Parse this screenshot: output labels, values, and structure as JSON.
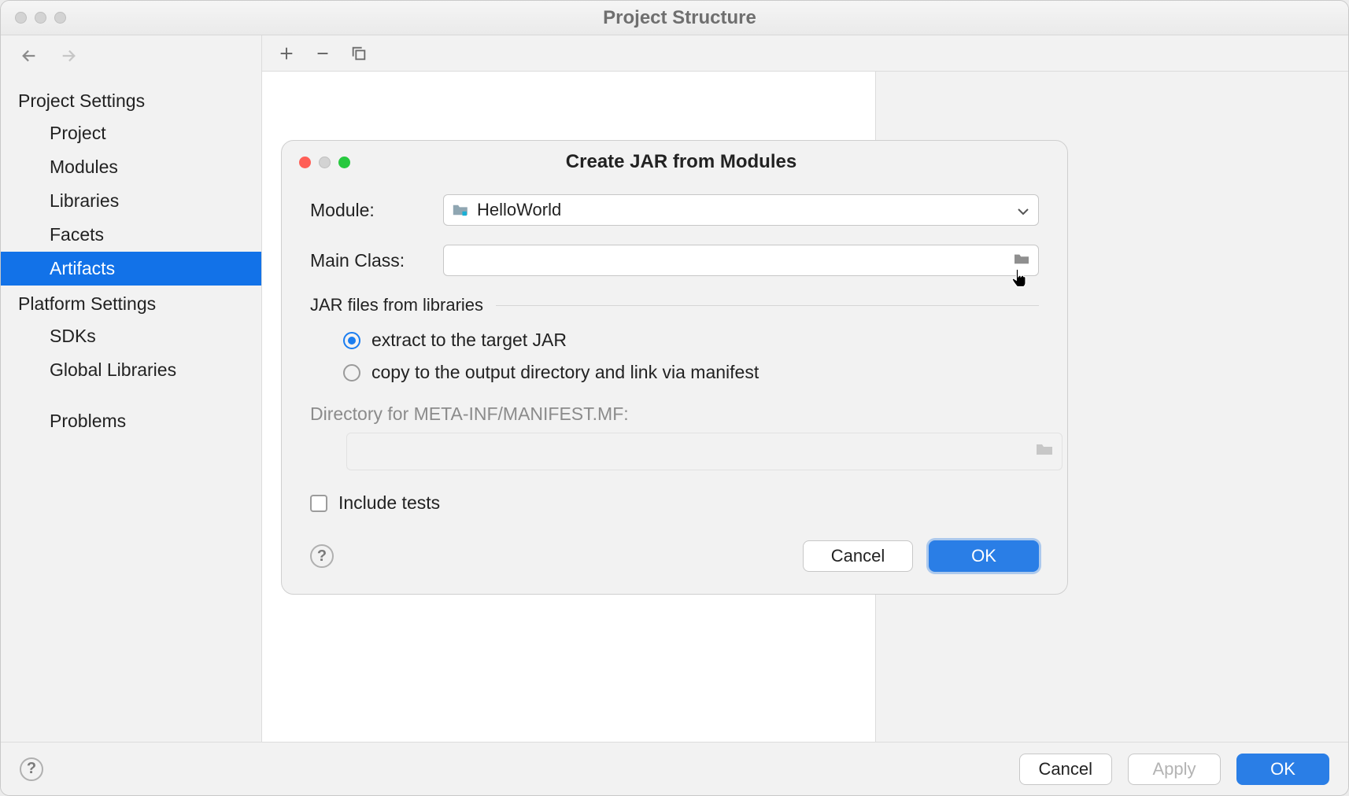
{
  "window": {
    "title": "Project Structure"
  },
  "sidebar": {
    "section1": "Project Settings",
    "items1": [
      "Project",
      "Modules",
      "Libraries",
      "Facets",
      "Artifacts"
    ],
    "section2": "Platform Settings",
    "items2": [
      "SDKs",
      "Global Libraries"
    ],
    "section3": "",
    "items3": [
      "Problems"
    ]
  },
  "footer": {
    "cancel": "Cancel",
    "apply": "Apply",
    "ok": "OK"
  },
  "dialog": {
    "title": "Create JAR from Modules",
    "module_label": "Module:",
    "module_value": "HelloWorld",
    "mainclass_label": "Main Class:",
    "mainclass_value": "",
    "jar_section": "JAR files from libraries",
    "radio_extract": "extract to the target JAR",
    "radio_copy": "copy to the output directory and link via manifest",
    "manifest_label": "Directory for META-INF/MANIFEST.MF:",
    "manifest_value": "",
    "include_tests": "Include tests",
    "cancel": "Cancel",
    "ok": "OK"
  }
}
